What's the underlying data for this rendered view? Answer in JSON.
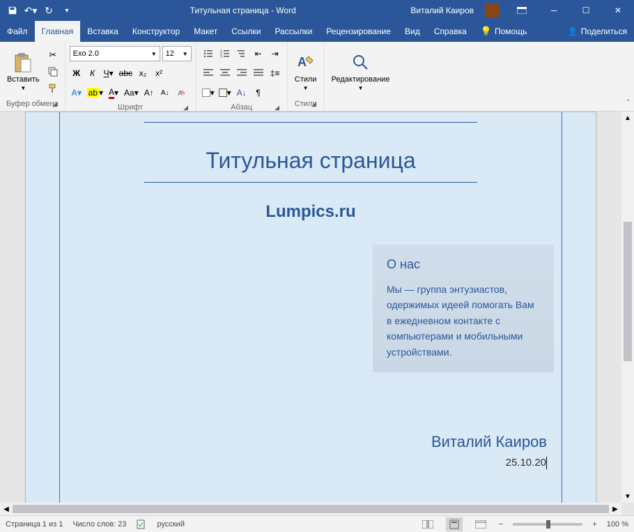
{
  "title": "Титульная страница  -  Word",
  "user": "Виталий Каиров",
  "tabs": {
    "file": "Файл",
    "home": "Главная",
    "insert": "Вставка",
    "design": "Конструктор",
    "layout": "Макет",
    "references": "Ссылки",
    "mailings": "Рассылки",
    "review": "Рецензирование",
    "view": "Вид",
    "help": "Справка",
    "tellme": "Помощь",
    "share": "Поделиться"
  },
  "ribbon": {
    "clipboard": {
      "paste": "Вставить",
      "label": "Буфер обмена"
    },
    "font": {
      "name": "Exo 2.0",
      "size": "12",
      "label": "Шрифт"
    },
    "paragraph": {
      "label": "Абзац"
    },
    "styles": {
      "btn": "Стили",
      "label": "Стили"
    },
    "editing": {
      "btn": "Редактирование"
    }
  },
  "document": {
    "main_title": "Титульная страница",
    "subtitle": "Lumpics.ru",
    "about_heading": "О нас",
    "about_body": "Мы — группа энтузиастов, одержимых идеей помогать Вам в ежедневном контакте с компьютерами и мобильными устройствами.",
    "author": "Виталий Каиров",
    "date": "25.10.20"
  },
  "status": {
    "page": "Страница 1 из 1",
    "words": "Число слов: 23",
    "language": "русский",
    "zoom": "100 %"
  }
}
